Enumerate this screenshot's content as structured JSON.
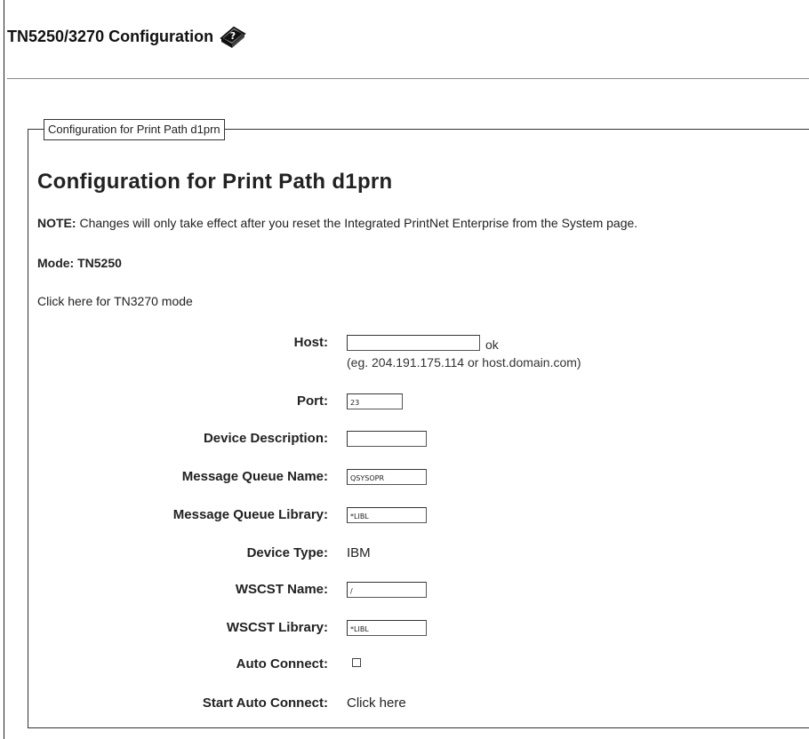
{
  "page": {
    "title": "TN5250/3270 Configuration",
    "help_icon": "help-book-icon"
  },
  "fieldset": {
    "legend": "Configuration for Print Path d1prn",
    "heading": "Configuration for Print Path d1prn",
    "note_label": "NOTE:",
    "note_text": " Changes will only take effect after you reset the Integrated PrintNet Enterprise from the System page.",
    "mode": "Mode: TN5250",
    "mode_link": "Click here for TN3270 mode"
  },
  "form": {
    "host": {
      "label": "Host:",
      "value": "",
      "status": "ok",
      "hint": "(eg. 204.191.175.114 or host.domain.com)"
    },
    "port": {
      "label": "Port:",
      "value": "23"
    },
    "device_description": {
      "label": "Device Description:",
      "value": ""
    },
    "message_queue_name": {
      "label": "Message Queue Name:",
      "value": "QSYSOPR"
    },
    "message_queue_library": {
      "label": "Message Queue Library:",
      "value": "*LIBL"
    },
    "device_type": {
      "label": "Device Type:",
      "value": "IBM"
    },
    "wscst_name": {
      "label": "WSCST Name:",
      "value": "/"
    },
    "wscst_library": {
      "label": "WSCST Library:",
      "value": "*LIBL"
    },
    "auto_connect": {
      "label": "Auto Connect:",
      "checked": false
    },
    "start_auto_connect": {
      "label": "Start Auto Connect:",
      "link": "Click here"
    }
  }
}
